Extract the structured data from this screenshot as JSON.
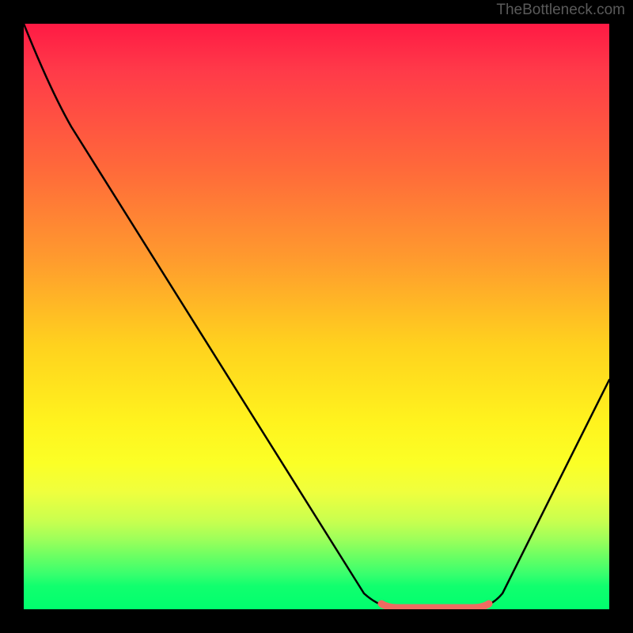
{
  "watermark": "TheBottleneck.com",
  "chart_data": {
    "type": "line",
    "title": "",
    "xlabel": "",
    "ylabel": "",
    "xlim": [
      0,
      100
    ],
    "ylim": [
      0,
      100
    ],
    "grid": false,
    "series": [
      {
        "name": "bottleneck-curve",
        "x": [
          0,
          5,
          10,
          20,
          30,
          40,
          50,
          58,
          63,
          68,
          73,
          78,
          82,
          88,
          94,
          100
        ],
        "y": [
          100,
          93,
          86,
          72,
          57,
          43,
          28,
          14,
          4,
          0.5,
          0.5,
          0.5,
          4,
          14,
          28,
          40
        ]
      },
      {
        "name": "flat-minimum-highlight",
        "x": [
          63,
          78
        ],
        "y": [
          0.5,
          0.5
        ]
      }
    ],
    "gradient_stops": [
      {
        "offset": 0,
        "color": "#ff1a44"
      },
      {
        "offset": 50,
        "color": "#ffd21e"
      },
      {
        "offset": 100,
        "color": "#00ff6e"
      }
    ],
    "highlight_color": "#ef6b61"
  }
}
